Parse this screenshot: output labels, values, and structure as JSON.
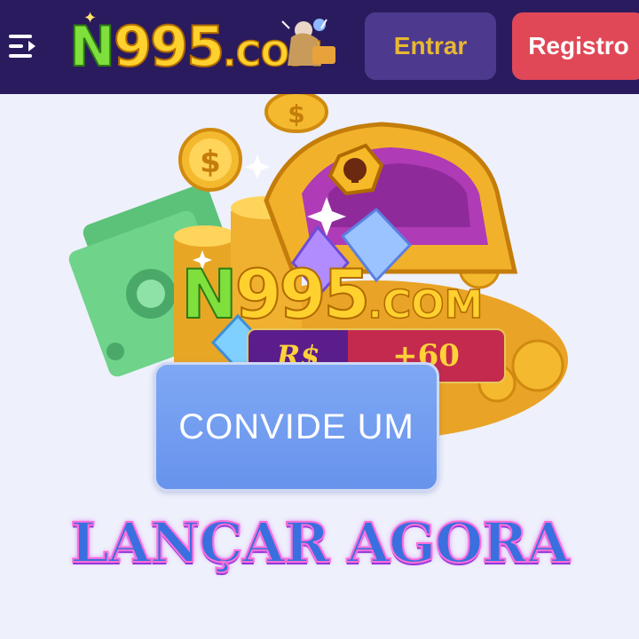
{
  "header": {
    "menu_icon": "menu-collapse-icon",
    "logo": {
      "main": "N995",
      "suffix": ".COM"
    },
    "login_label": "Entrar",
    "register_label": "Registro",
    "colors": {
      "bar": "#2a1b5e",
      "login_bg": "#4d3a8e",
      "login_text": "#e8b832",
      "register_bg": "#e04857"
    }
  },
  "promo": {
    "logo": {
      "main": "N995",
      "suffix": ".COM"
    },
    "reward": {
      "currency": "R$",
      "amount": "+60"
    },
    "invite_label": "CONVIDE UM",
    "launch_label": "LANÇAR AGORA",
    "illustration": [
      "treasure-chest",
      "gold-coins",
      "cash-bills",
      "diamonds"
    ],
    "colors": {
      "invite_bg": "#7ea8f4",
      "launch_text": "#3a6fe0",
      "launch_outline": "#ff6fd8"
    }
  }
}
